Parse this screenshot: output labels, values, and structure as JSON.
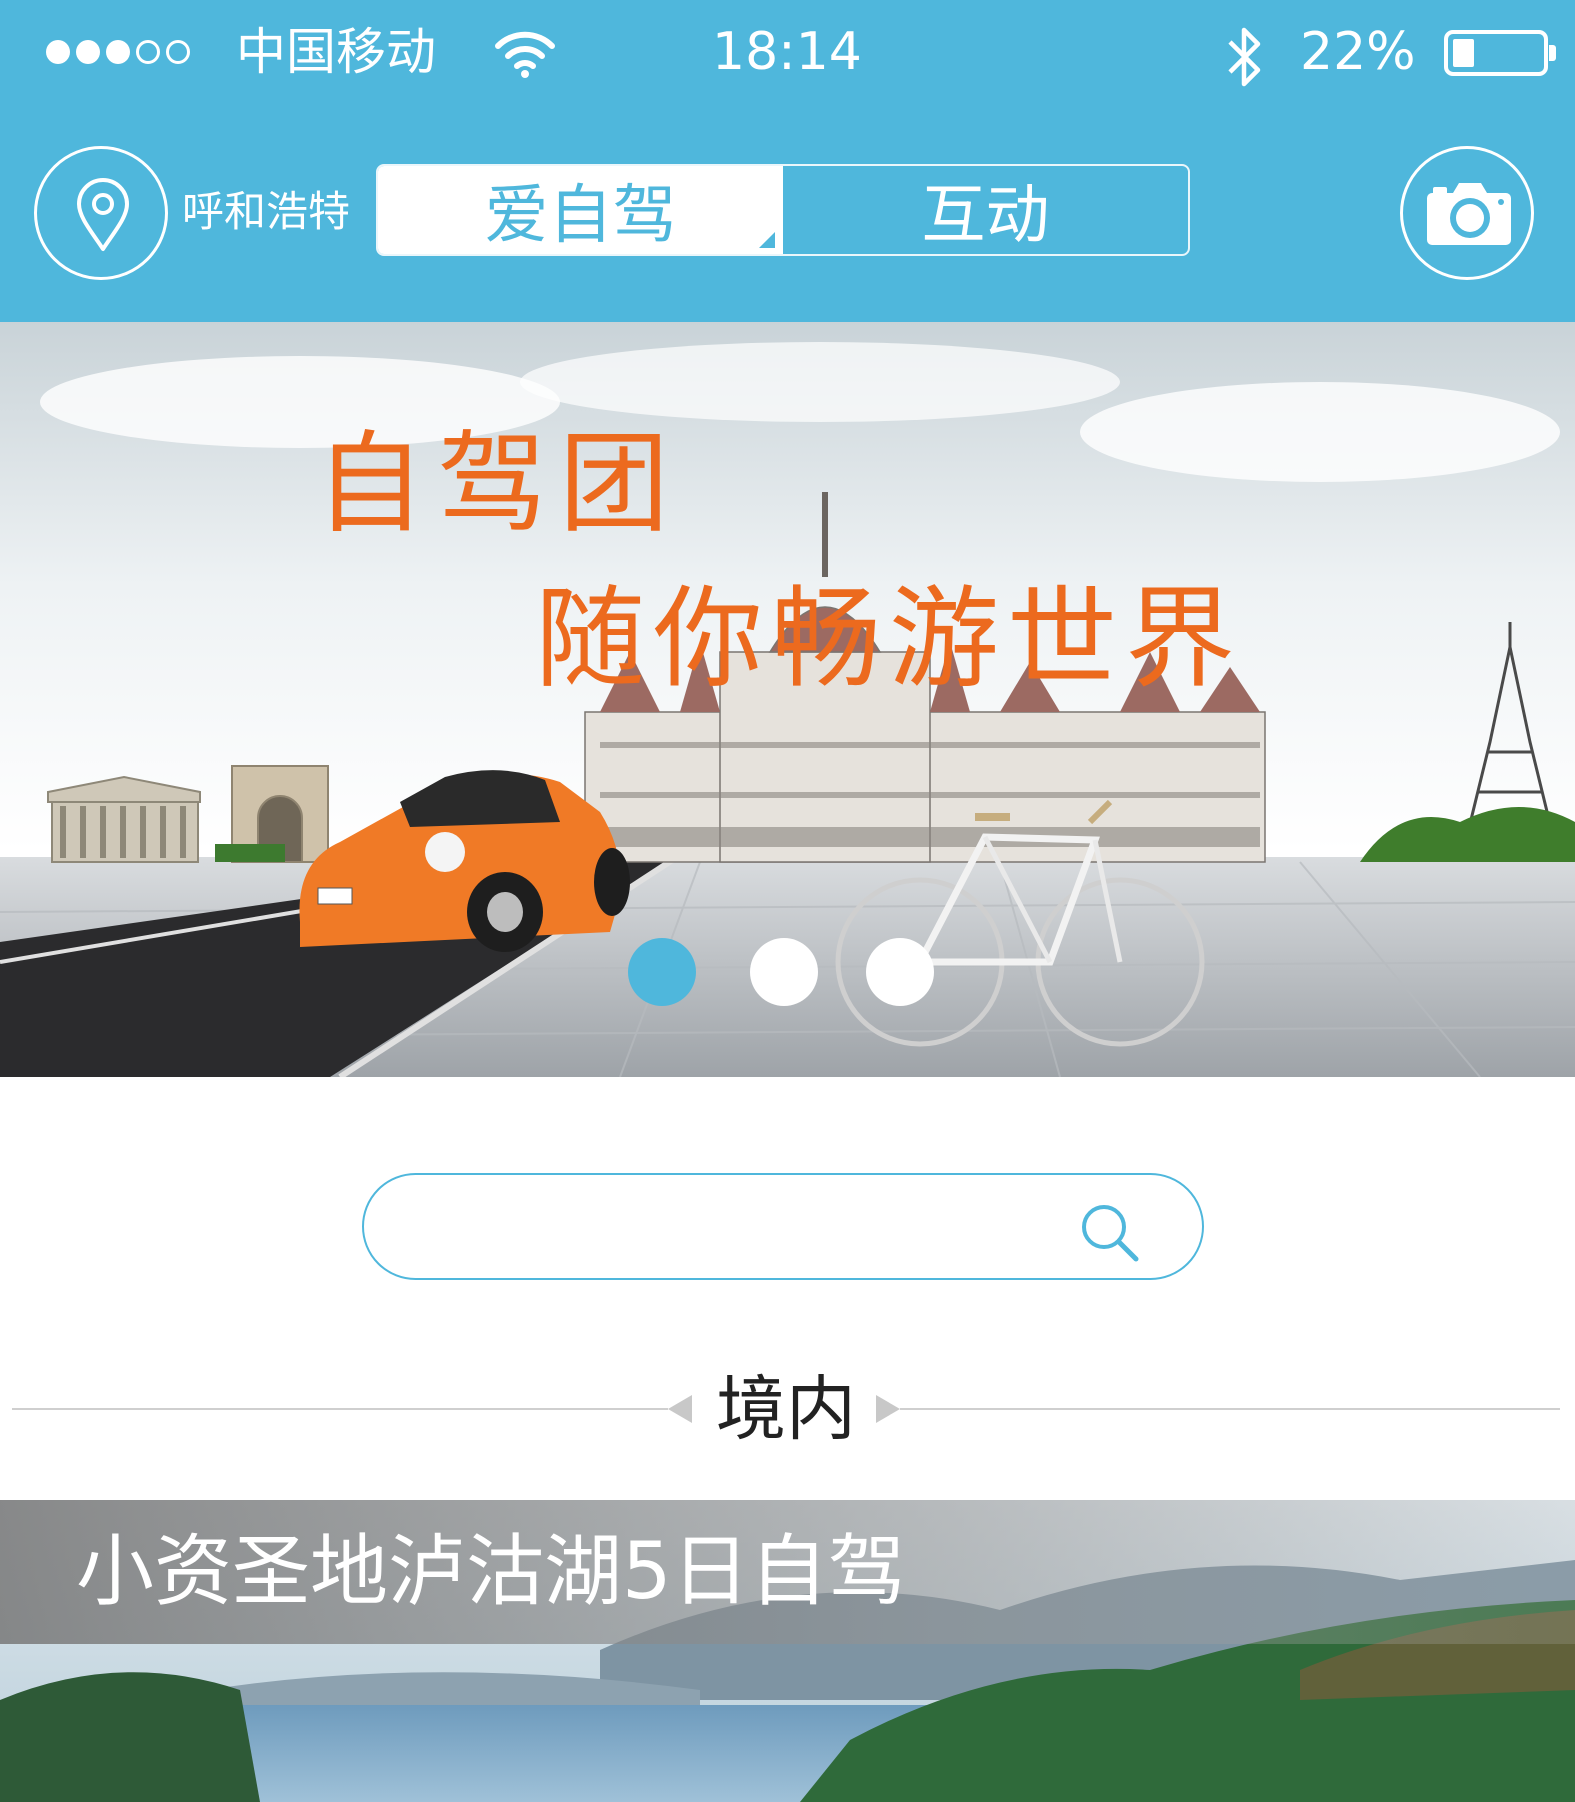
{
  "status_bar": {
    "signal_filled": 3,
    "signal_total": 5,
    "carrier": "中国移动",
    "time": "18:14",
    "battery_percent": "22%",
    "battery_level": 0.22
  },
  "nav": {
    "city": "呼和浩特",
    "tabs": [
      {
        "label": "爱自驾",
        "active": true
      },
      {
        "label": "互动",
        "active": false
      }
    ]
  },
  "banner": {
    "headline_line1": "自驾团",
    "headline_line2": "随你畅游世界",
    "slides_total": 3,
    "active_slide": 1
  },
  "search": {
    "value": "",
    "placeholder": ""
  },
  "section": {
    "title": "境内"
  },
  "cards": [
    {
      "title": "小资圣地泸沽湖5日自驾"
    }
  ],
  "colors": {
    "primary": "#4fb7dc",
    "headline": "#ec6a1e",
    "car": "#f07a26"
  },
  "icons": {
    "location": "map-pin-icon",
    "camera": "camera-icon",
    "search": "search-icon",
    "wifi": "wifi-icon",
    "bluetooth": "bluetooth-icon",
    "battery": "battery-icon"
  }
}
